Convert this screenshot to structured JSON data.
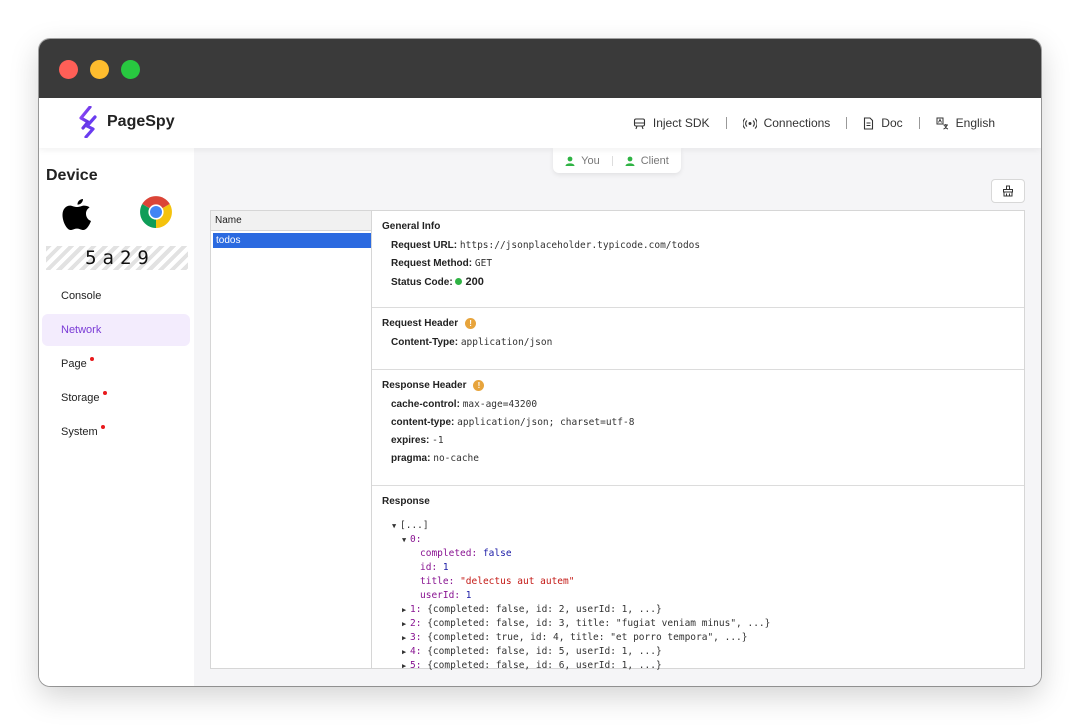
{
  "app": {
    "name": "PageSpy"
  },
  "nav": [
    {
      "label": "Inject SDK",
      "icon": "inject-sdk-icon"
    },
    {
      "label": "Connections",
      "icon": "connections-icon"
    },
    {
      "label": "Doc",
      "icon": "doc-icon"
    },
    {
      "label": "English",
      "icon": "language-icon"
    }
  ],
  "sidebar": {
    "title": "Device",
    "device_code": "5a29",
    "os_icon": "apple-icon",
    "browser_icon": "chrome-icon",
    "menu": [
      {
        "label": "Console",
        "active": false,
        "dot": false
      },
      {
        "label": "Network",
        "active": true,
        "dot": false
      },
      {
        "label": "Page",
        "active": false,
        "dot": true
      },
      {
        "label": "Storage",
        "active": false,
        "dot": true
      },
      {
        "label": "System",
        "active": false,
        "dot": true
      }
    ]
  },
  "roles": {
    "you": "You",
    "client": "Client"
  },
  "network": {
    "list_header": "Name",
    "requests": [
      "todos"
    ],
    "general": {
      "title": "General Info",
      "url_label": "Request URL:",
      "url": "https://jsonplaceholder.typicode.com/todos",
      "method_label": "Request Method:",
      "method": "GET",
      "status_label": "Status Code:",
      "status": "200"
    },
    "request_header": {
      "title": "Request Header",
      "items": [
        {
          "k": "Content-Type:",
          "v": "application/json"
        }
      ]
    },
    "response_header": {
      "title": "Response Header",
      "items": [
        {
          "k": "cache-control:",
          "v": "max-age=43200"
        },
        {
          "k": "content-type:",
          "v": "application/json; charset=utf-8"
        },
        {
          "k": "expires:",
          "v": "-1"
        },
        {
          "k": "pragma:",
          "v": "no-cache"
        }
      ]
    },
    "response": {
      "title": "Response",
      "root": "[...]",
      "expanded_key": "0:",
      "fields": [
        {
          "k": "completed:",
          "v": "false",
          "type": "bool"
        },
        {
          "k": "id:",
          "v": "1",
          "type": "num"
        },
        {
          "k": "title:",
          "v": "\"delectus aut autem\"",
          "type": "str"
        },
        {
          "k": "userId:",
          "v": "1",
          "type": "num"
        }
      ],
      "collapsed": [
        {
          "k": "1:",
          "v": "{completed: false, id: 2, userId: 1, ...}"
        },
        {
          "k": "2:",
          "v": "{completed: false, id: 3, title: \"fugiat veniam minus\", ...}"
        },
        {
          "k": "3:",
          "v": "{completed: true, id: 4, title: \"et porro tempora\", ...}"
        },
        {
          "k": "4:",
          "v": "{completed: false, id: 5, userId: 1, ...}"
        },
        {
          "k": "5:",
          "v": "{completed: false, id: 6, userId: 1, ...}"
        }
      ]
    }
  },
  "colors": {
    "accent": "#7a3bd6",
    "selected_row": "#2b6ae0",
    "status_ok": "#2fb344",
    "info": "#e7a43c"
  }
}
